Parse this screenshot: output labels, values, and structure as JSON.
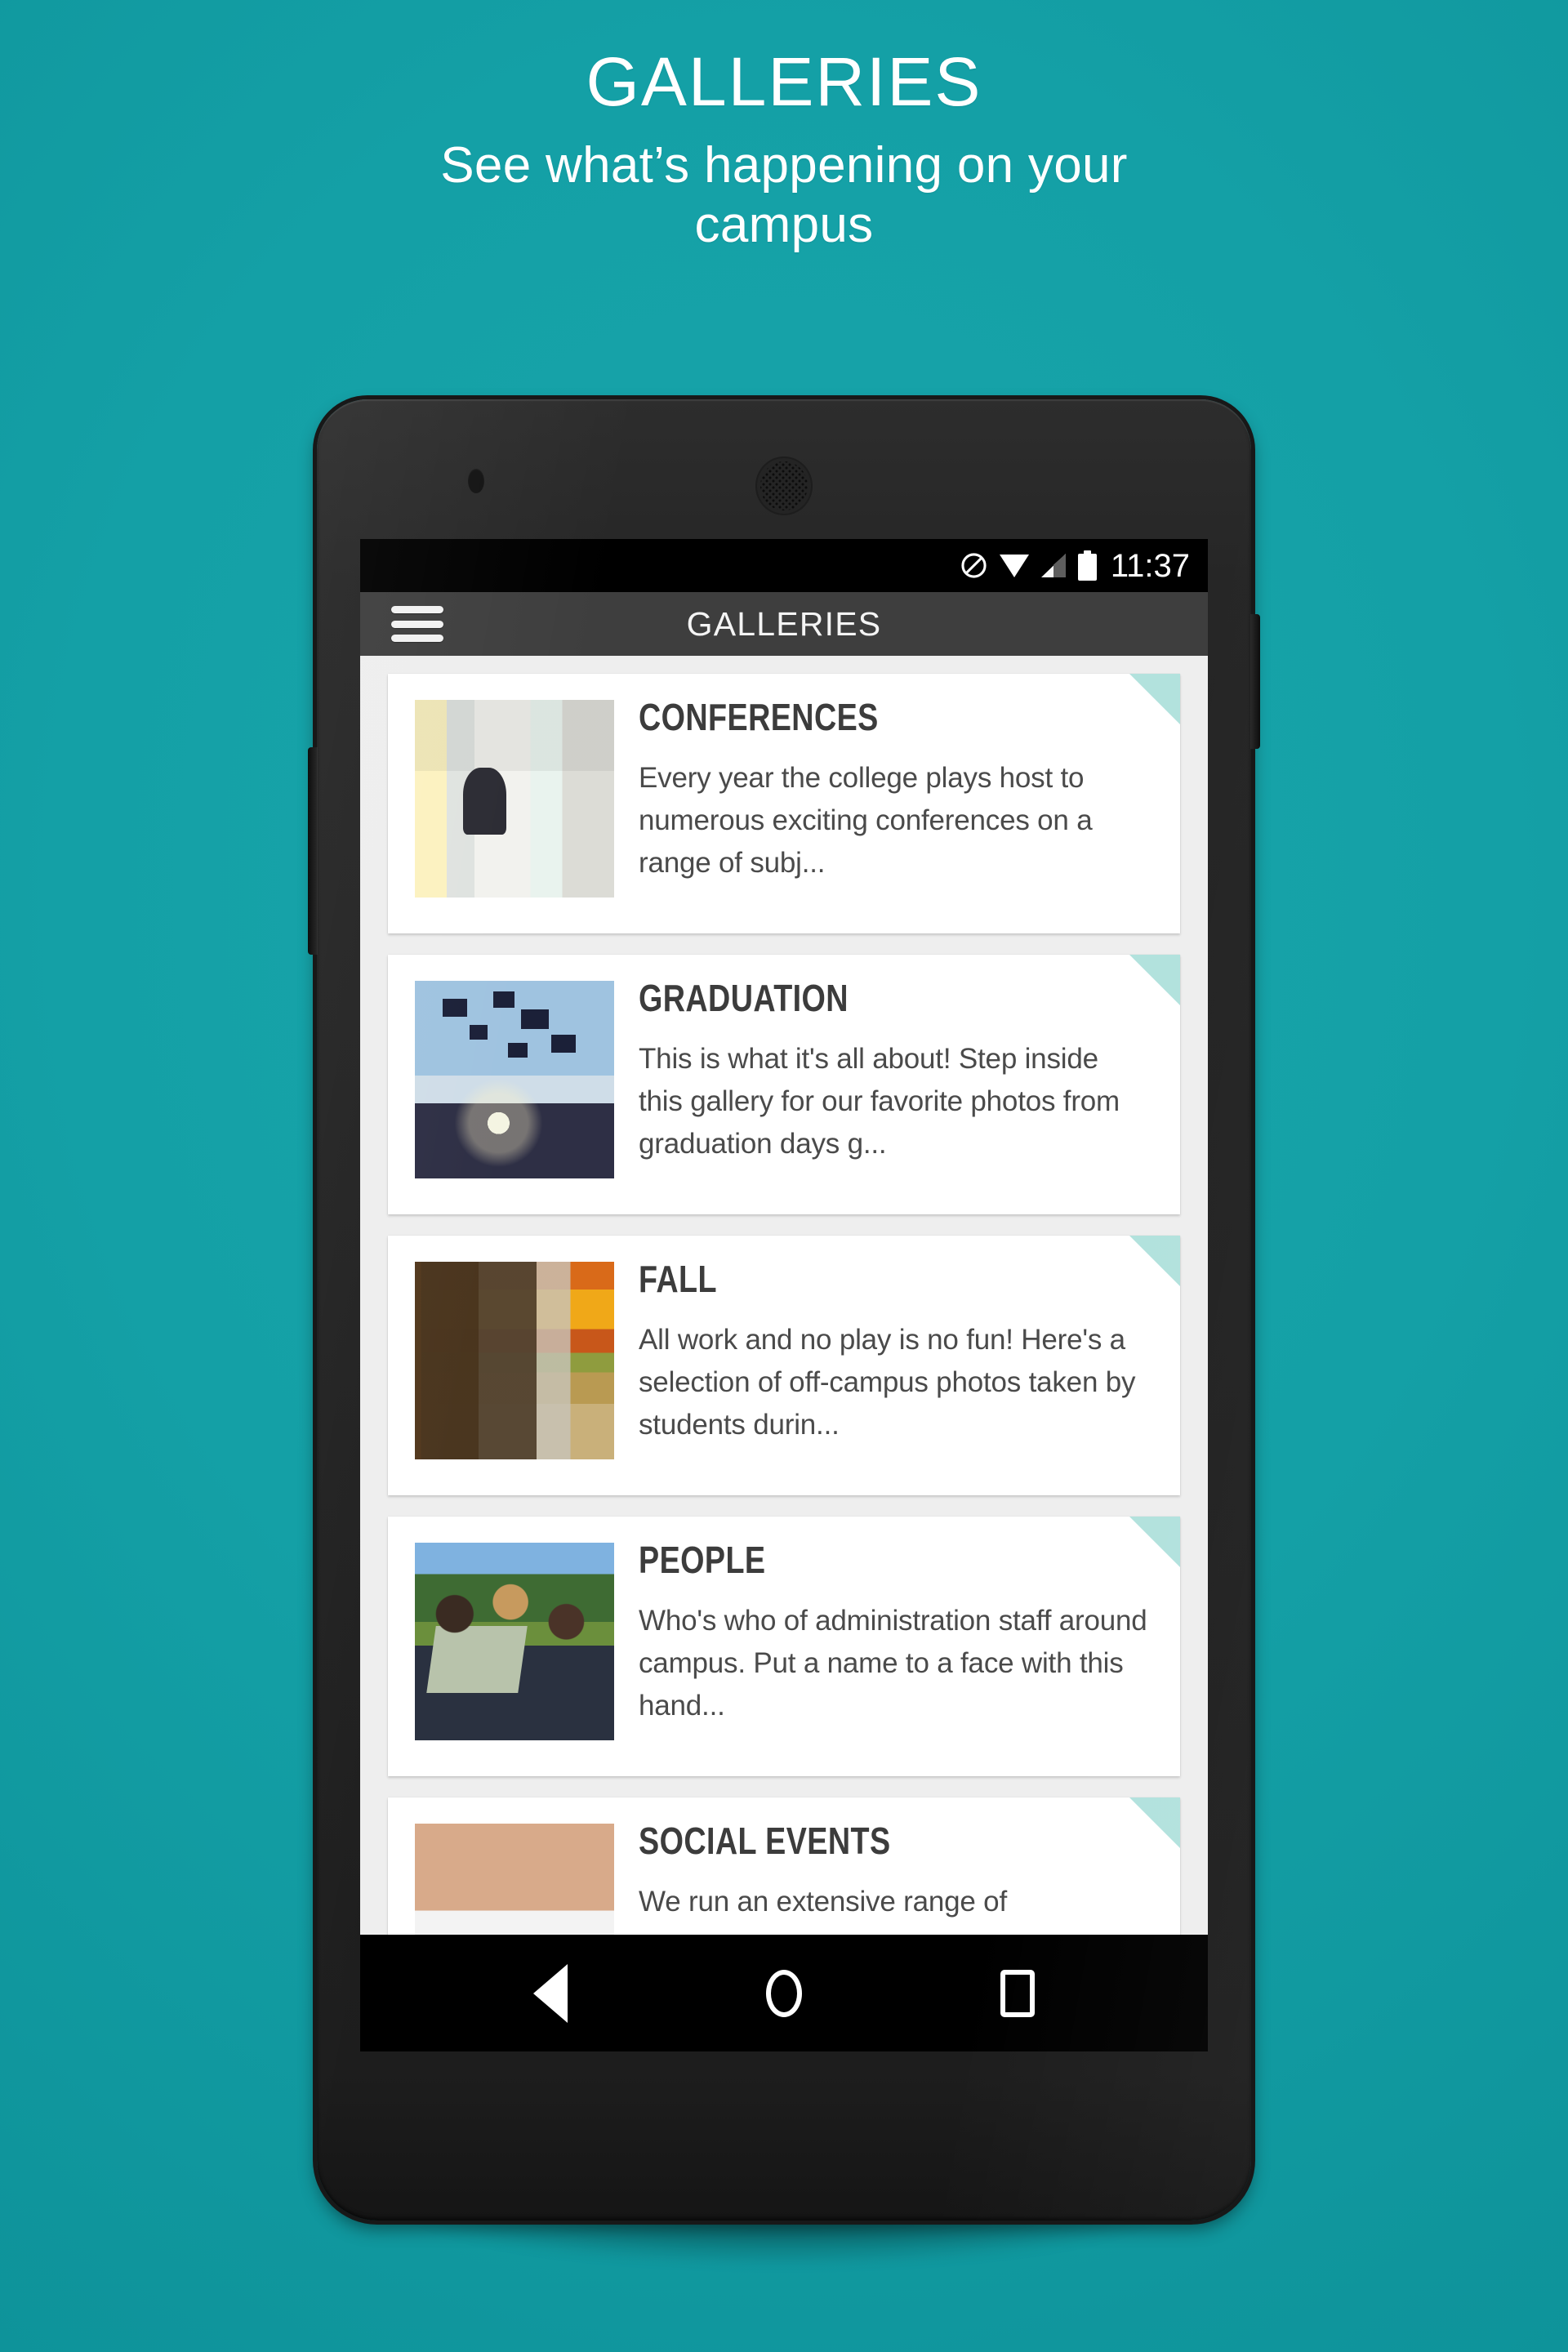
{
  "promo": {
    "title": "GALLERIES",
    "subtitle": "See what’s happening on your campus"
  },
  "colors": {
    "background_top": "#109a9f",
    "background_bottom": "#0c8d95",
    "card_corner_accent": "#b2e2dd",
    "action_bar": "#3e3e3e",
    "list_background": "#eeeeee",
    "card_background": "#ffffff",
    "status_bar": "#000000",
    "nav_bar": "#000000"
  },
  "device": {
    "status_bar": {
      "clock": "11:37",
      "icons": [
        "do-not-disturb-icon",
        "wifi-icon",
        "cellular-signal-icon",
        "battery-icon"
      ]
    },
    "nav_bar": {
      "back_label": "Back",
      "home_label": "Home",
      "recents_label": "Recent apps"
    },
    "hardware": {
      "earpiece": "earpiece-speaker",
      "front_camera": "front-camera",
      "volume_button": "volume-rocker",
      "power_button": "power-button"
    }
  },
  "app": {
    "action_bar": {
      "menu_label": "Menu",
      "title": "GALLERIES"
    },
    "galleries": [
      {
        "title": "CONFERENCES",
        "description": "Every year the college plays host to numerous exciting conferences on a range of subj...",
        "thumb": "conferences-thumbnail"
      },
      {
        "title": "GRADUATION",
        "description": "This is what it's all about!  Step inside this gallery for our favorite photos from graduation days g...",
        "thumb": "graduation-thumbnail"
      },
      {
        "title": "FALL",
        "description": "All work and no play is no fun! Here's a selection of off-campus photos taken by students durin...",
        "thumb": "fall-thumbnail"
      },
      {
        "title": "PEOPLE",
        "description": "Who's who of administration staff around campus.  Put a name to a face with this hand...",
        "thumb": "people-thumbnail"
      },
      {
        "title": "SOCIAL EVENTS",
        "description": "We run an extensive range of",
        "thumb": "social-events-thumbnail"
      }
    ]
  }
}
